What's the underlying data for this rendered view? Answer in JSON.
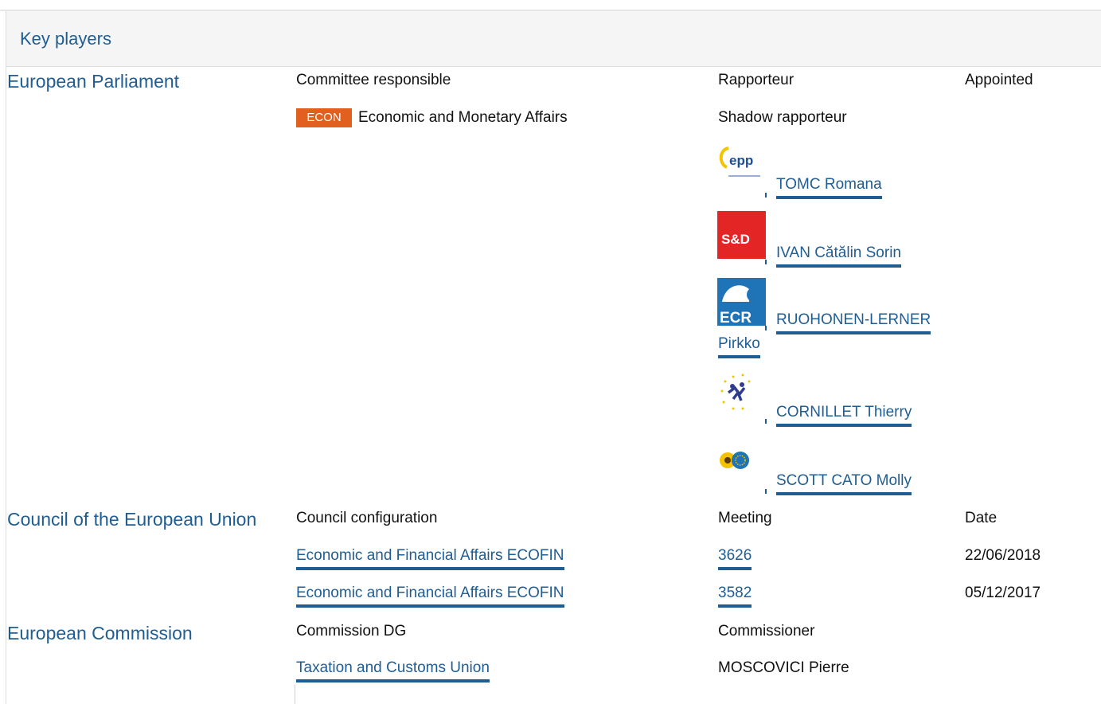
{
  "header": {
    "title": "Key players"
  },
  "parliament": {
    "label": "European Parliament",
    "col_committee": "Committee responsible",
    "col_rapporteur": "Rapporteur",
    "col_appointed": "Appointed",
    "committee_badge": "ECON",
    "committee_name": "Economic and Monetary Affairs",
    "shadow_label": "Shadow rapporteur",
    "shadows": [
      {
        "name": "TOMC Romana",
        "group": "EPP",
        "logo_text": "epp",
        "icon": "epp-logo-icon"
      },
      {
        "name": "IVAN Cătălin Sorin",
        "group": "S&D",
        "logo_text": "S&D",
        "icon": "sd-logo-icon"
      },
      {
        "name": "RUOHONEN-LERNER",
        "name_cont": "Pirkko",
        "group": "ECR",
        "logo_text": "ECR",
        "icon": "ecr-logo-icon"
      },
      {
        "name": "CORNILLET Thierry",
        "group": "ALDE",
        "icon": "alde-logo-icon"
      },
      {
        "name": "SCOTT CATO Molly",
        "group": "Verts/ALE",
        "icon": "greens-logo-icon"
      }
    ]
  },
  "council": {
    "label": "Council of the European Union",
    "col_config": "Council configuration",
    "col_meeting": "Meeting",
    "col_date": "Date",
    "rows": [
      {
        "config": "Economic and Financial Affairs ECOFIN",
        "meeting": "3626",
        "date": "22/06/2018"
      },
      {
        "config": "Economic and Financial Affairs ECOFIN",
        "meeting": "3582",
        "date": "05/12/2017"
      }
    ]
  },
  "commission": {
    "label": "European Commission",
    "col_dg": "Commission DG",
    "col_commissioner": "Commissioner",
    "dg": "Taxation and Customs Union",
    "commissioner": "MOSCOVICI Pierre"
  },
  "colors": {
    "accent": "#1f5d93",
    "badge": "#e1601f",
    "sd_red": "#e32526",
    "ecr_blue": "#1f73b7"
  }
}
